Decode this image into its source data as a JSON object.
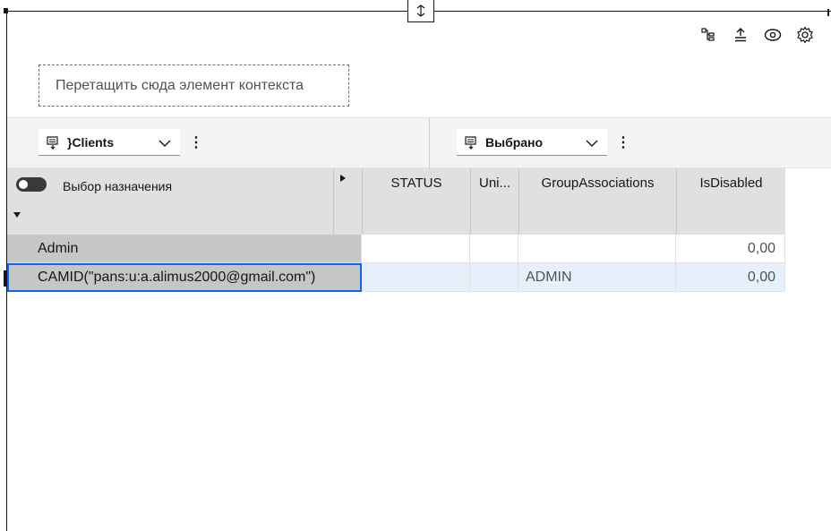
{
  "context": {
    "drop_zone_text": "Перетащить сюда элемент контекста"
  },
  "toolbar": {
    "icons": [
      "hierarchy-icon",
      "align-top-icon",
      "eye-icon",
      "gear-icon"
    ]
  },
  "selectors": {
    "rows_dimension": "}Clients",
    "columns_dimension": "Выбрано"
  },
  "grid": {
    "assignment_toggle_label": "Выбор назначения",
    "columns": [
      "STATUS",
      "Uni...",
      "GroupAssociations",
      "IsDisabled"
    ],
    "rows": [
      {
        "label": "Admin",
        "status": "",
        "uni": "",
        "group_associations": "",
        "is_disabled": "0,00"
      },
      {
        "label": "CAMID(\"pans:u:a.alimus2000@gmail.com\")",
        "status": "",
        "uni": "",
        "group_associations": "ADMIN",
        "is_disabled": "0,00"
      }
    ]
  }
}
